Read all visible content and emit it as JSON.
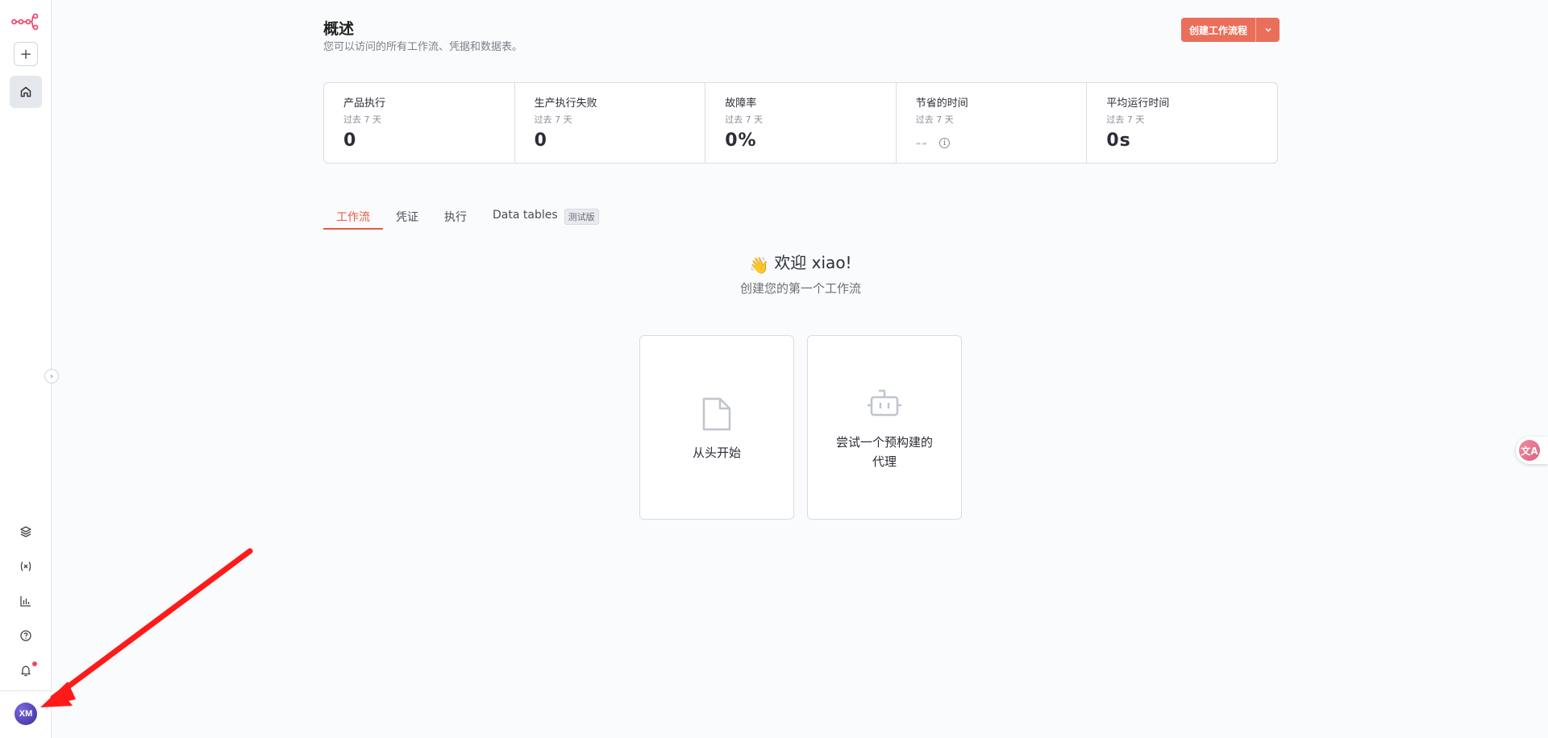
{
  "colors": {
    "accent": "#ea5a46",
    "primary_button": "#ea6f5a",
    "sidebar_active_bg": "#e4e7ec",
    "annotation_arrow": "#ff1a1a"
  },
  "sidebar": {
    "add_label": "+",
    "collapse_label": "›",
    "avatar_initials": "XM",
    "icons": [
      "n8n-logo-icon",
      "plus-icon",
      "home-icon",
      "templates-icon",
      "variables-icon",
      "insights-icon",
      "help-icon",
      "bell-icon"
    ]
  },
  "header": {
    "title": "概述",
    "subtitle": "您可以访问的所有工作流、凭据和数据表。",
    "create_button": "创建工作流程"
  },
  "stats": [
    {
      "label": "产品执行",
      "period": "过去 7 天",
      "value": "0"
    },
    {
      "label": "生产执行失败",
      "period": "过去 7 天",
      "value": "0"
    },
    {
      "label": "故障率",
      "period": "过去 7 天",
      "value": "0%"
    },
    {
      "label": "节省的时间",
      "period": "过去 7 天",
      "value": "--"
    },
    {
      "label": "平均运行时间",
      "period": "过去 7 天",
      "value": "0s"
    }
  ],
  "tabs": [
    {
      "label": "工作流",
      "active": true
    },
    {
      "label": "凭证"
    },
    {
      "label": "执行"
    },
    {
      "label": "Data tables",
      "badge": "测试版"
    }
  ],
  "welcome": {
    "emoji": "👋",
    "greeting": "欢迎 xiao!",
    "subtitle": "创建您的第一个工作流"
  },
  "cards": [
    {
      "label": "从头开始",
      "icon": "file-icon"
    },
    {
      "label_line1": "尝试一个预构建的",
      "label_line2": "代理",
      "icon": "robot-icon"
    }
  ],
  "float_button": {
    "label": "文A"
  }
}
